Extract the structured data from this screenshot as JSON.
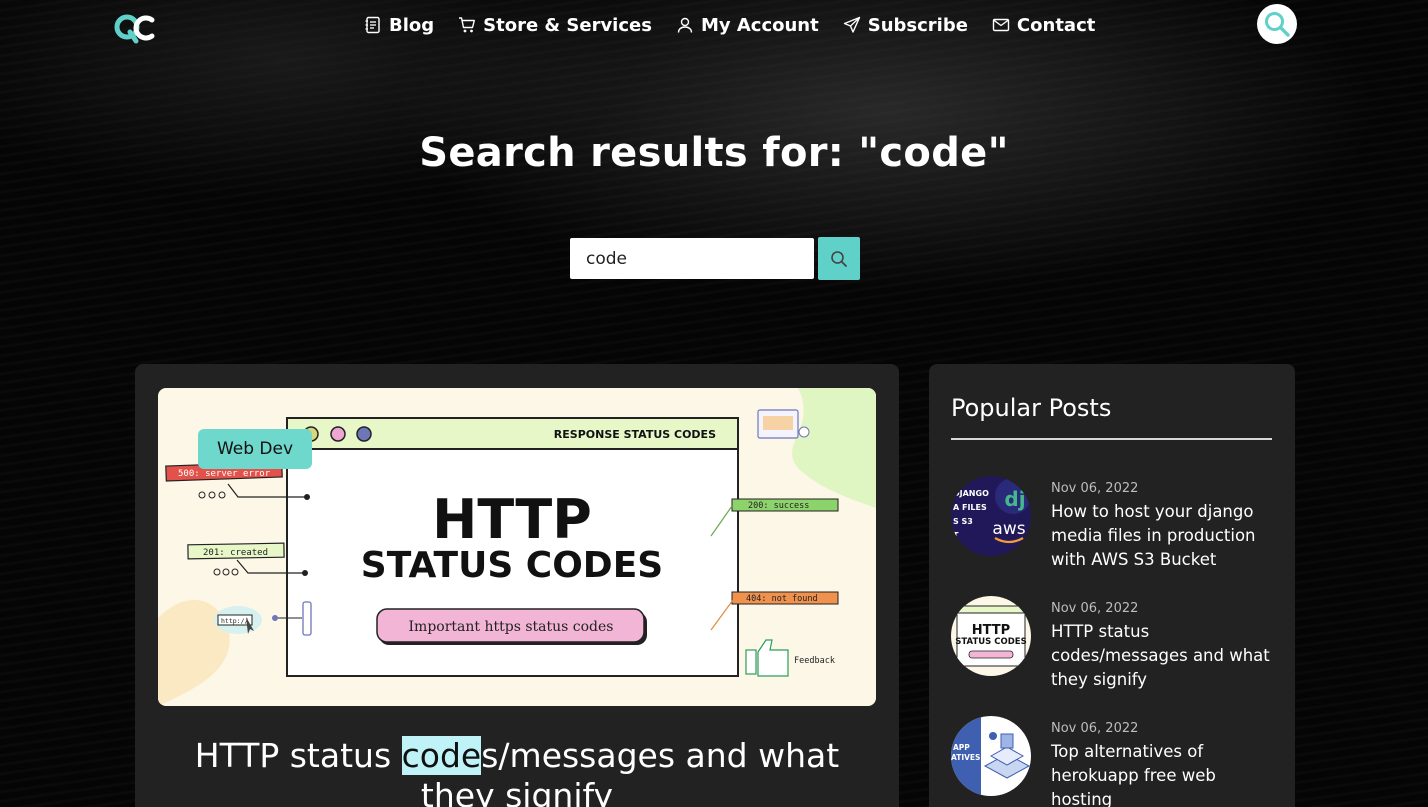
{
  "nav": {
    "items": [
      {
        "label": "Blog",
        "icon": "notebook-icon"
      },
      {
        "label": "Store & Services",
        "icon": "cart-icon"
      },
      {
        "label": "My Account",
        "icon": "user-icon"
      },
      {
        "label": "Subscribe",
        "icon": "paper-plane-icon"
      },
      {
        "label": "Contact",
        "icon": "envelope-icon"
      }
    ]
  },
  "colors": {
    "accent": "#5fd1c9",
    "badge": "#6fd8cc",
    "highlight": "#bff3f7"
  },
  "hero": {
    "title": "Search results for: \"code\"",
    "search_value": "code"
  },
  "results": [
    {
      "category": "Web Dev",
      "title_before": "HTTP status ",
      "title_match": "code",
      "title_after": "s/messages and what they signify",
      "thumbnail": {
        "header": "RESPONSE STATUS CODES",
        "headline_1": "HTTP",
        "headline_2": "STATUS CODES",
        "subtitle": "Important https status codes",
        "tags": [
          "500: server error",
          "201: created",
          "200: success",
          "404: not found"
        ],
        "url_chip": "http://",
        "feedback": "Feedback"
      }
    }
  ],
  "sidebar": {
    "title": "Popular Posts",
    "posts": [
      {
        "date": "Nov 06, 2022",
        "title": "How to host your django media files in production with AWS S3 Bucket",
        "thumb_text_1": "DJANGO",
        "thumb_text_2": "A FILES",
        "thumb_text_3": "S S3",
        "thumb_text_4": "T",
        "thumb_brand": "aws"
      },
      {
        "date": "Nov 06, 2022",
        "title": "HTTP status codes/messages and what they signify",
        "thumb_text_1": "HTTP",
        "thumb_text_2": "STATUS CODES"
      },
      {
        "date": "Nov 06, 2022",
        "title": "Top alternatives of herokuapp free web hosting",
        "thumb_text_1": "APP",
        "thumb_text_2": "ATIVES?"
      }
    ]
  }
}
